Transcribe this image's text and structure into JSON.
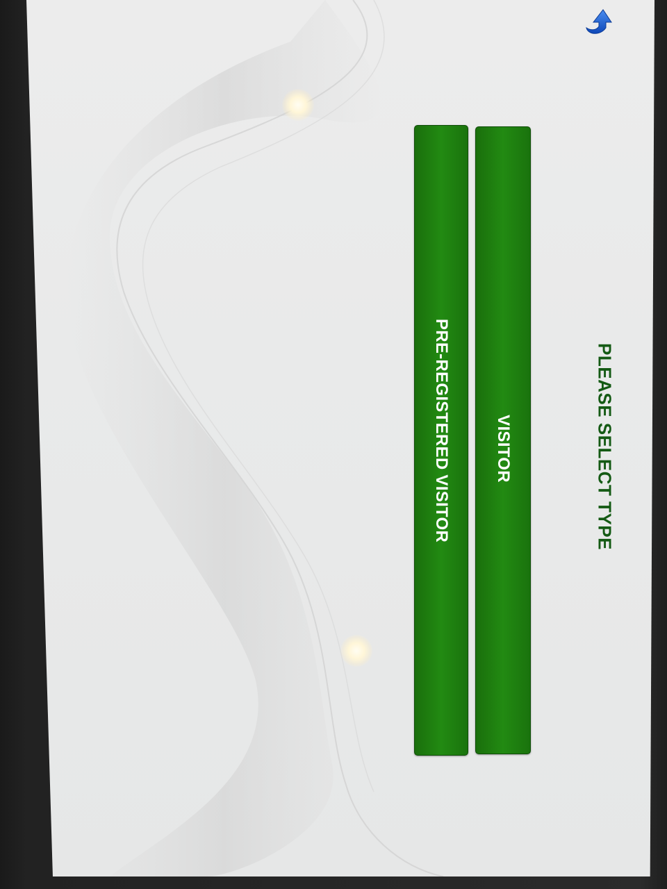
{
  "header": {
    "title": "PLEASE SELECT TYPE"
  },
  "actions": {
    "visitor_label": "VISITOR",
    "pre_registered_label": "PRE-REGISTERED VISITOR"
  },
  "navigation": {
    "back_icon": "back-arrow-icon"
  },
  "colors": {
    "accent_green": "#228a12",
    "title_green": "#145a14",
    "back_icon_blue": "#1a5fd6",
    "background": "#ebebeb"
  }
}
